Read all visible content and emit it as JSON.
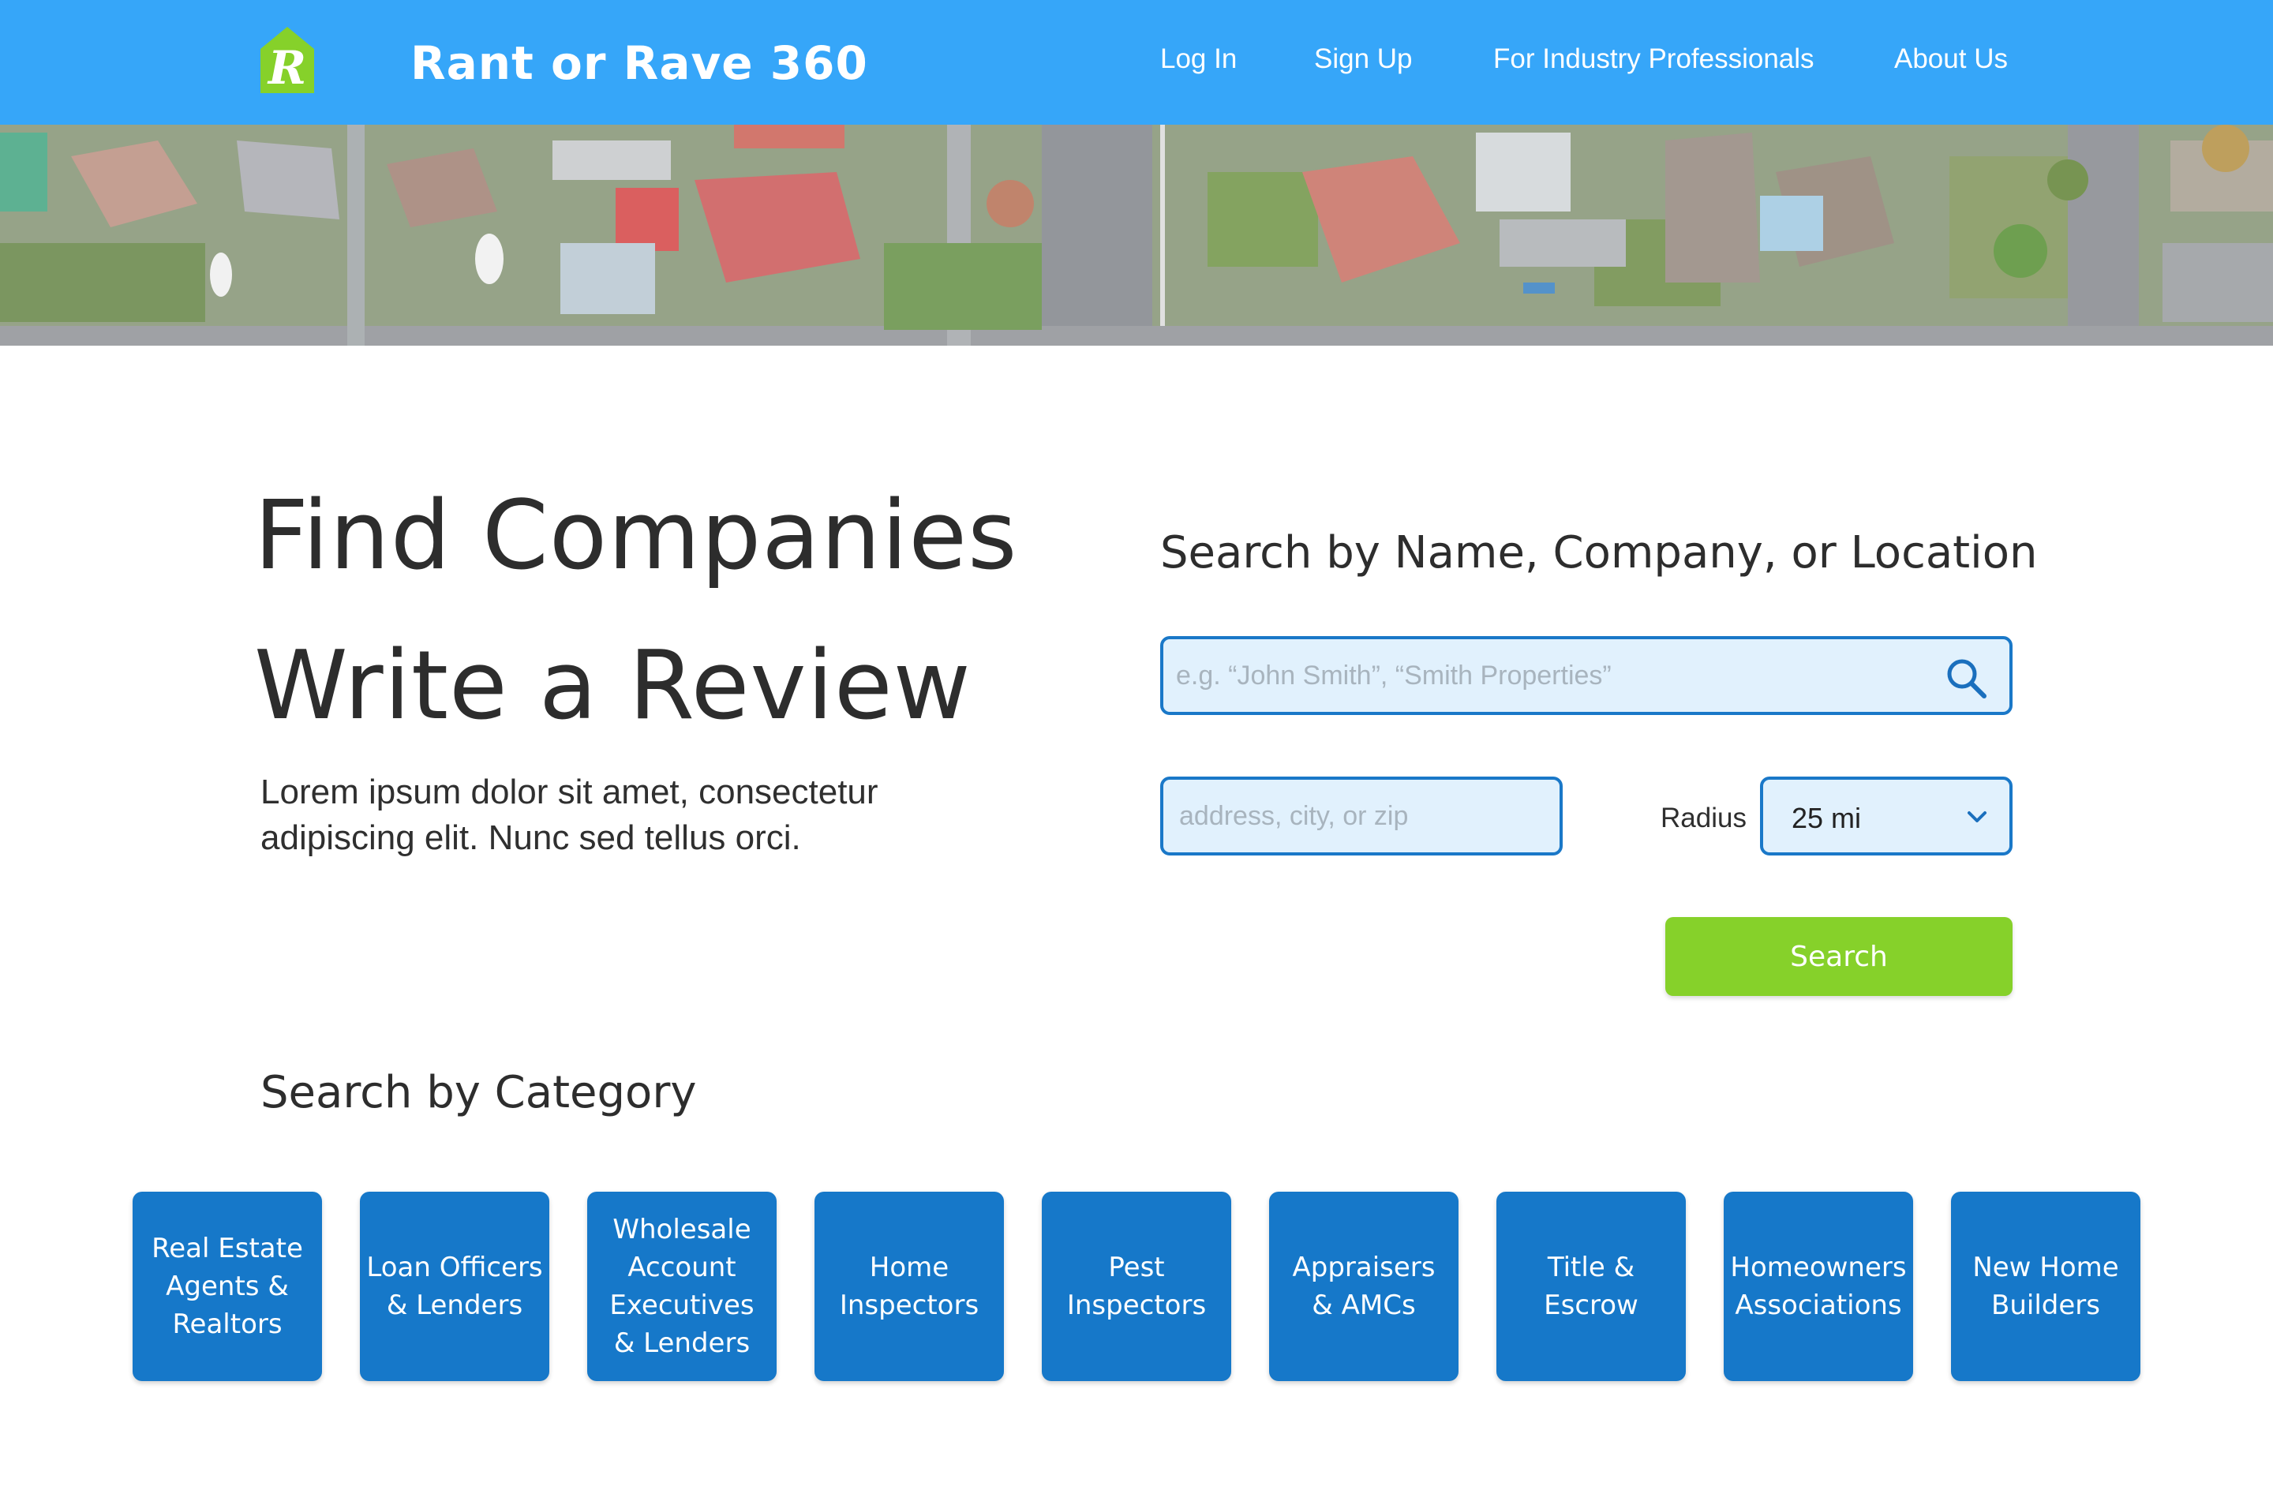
{
  "header": {
    "brand": "Rant or Rave 360",
    "nav": [
      {
        "label": "Log In"
      },
      {
        "label": "Sign Up"
      },
      {
        "label": "For Industry Professionals"
      },
      {
        "label": "About Us"
      }
    ]
  },
  "hero": {
    "headline_1": "Find Companies",
    "headline_2": "Write a Review",
    "lead": "Lorem ipsum dolor sit amet, consectetur adipiscing elit. Nunc sed tellus orci."
  },
  "search": {
    "title": "Search by Name, Company, or Location",
    "name_placeholder": "e.g. “John Smith”, “Smith Properties”",
    "location_placeholder": "address, city, or zip",
    "radius_label": "Radius",
    "radius_value": "25 mi",
    "button_label": "Search"
  },
  "categories": {
    "title": "Search by Category",
    "items": [
      {
        "label": "Real Estate\nAgents &\nRealtors"
      },
      {
        "label": "Loan Officers\n& Lenders"
      },
      {
        "label": "Wholesale\nAccount\nExecutives\n& Lenders"
      },
      {
        "label": "Home\nInspectors"
      },
      {
        "label": "Pest\nInspectors"
      },
      {
        "label": "Appraisers\n& AMCs"
      },
      {
        "label": "Title &\nEscrow"
      },
      {
        "label": "Homeowners\nAssociations"
      },
      {
        "label": "New Home\nBuilders"
      }
    ]
  },
  "colors": {
    "header_bg": "#36a6f9",
    "logo_green": "#86d12a",
    "input_border": "#1a78c8",
    "input_bg": "#e1f1fd",
    "search_button": "#86d12a",
    "category_card": "#1678c9"
  },
  "icons": {
    "logo": "house-r-logo",
    "search": "magnifier-icon",
    "dropdown": "chevron-down-icon"
  }
}
